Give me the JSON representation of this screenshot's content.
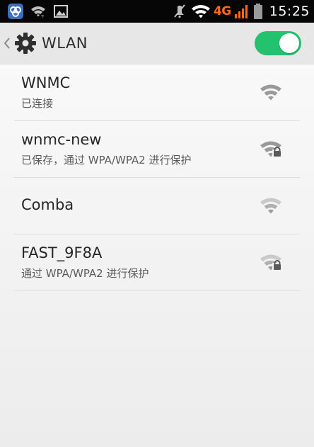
{
  "status_bar": {
    "time": "15:25",
    "network_type": "4G",
    "network_color": "#ff6a13",
    "icons": [
      "app-notification-icon",
      "wifi-notification-icon",
      "image-notification-icon",
      "silent-icon",
      "wifi-signal-icon",
      "cell-signal-icon",
      "battery-icon"
    ]
  },
  "header": {
    "back_icon": "chevron-left-icon",
    "settings_icon": "gear-icon",
    "title": "WLAN",
    "toggle_on": true,
    "toggle_color": "#22c26f"
  },
  "networks": [
    {
      "name": "WNMC",
      "status": "已连接",
      "secured": false
    },
    {
      "name": "wnmc-new",
      "status": "已保存，通过 WPA/WPA2 进行保护",
      "secured": true
    },
    {
      "name": "Comba",
      "status": "",
      "secured": false
    },
    {
      "name": "FAST_9F8A",
      "status": "通过 WPA/WPA2 进行保护",
      "secured": true
    }
  ]
}
